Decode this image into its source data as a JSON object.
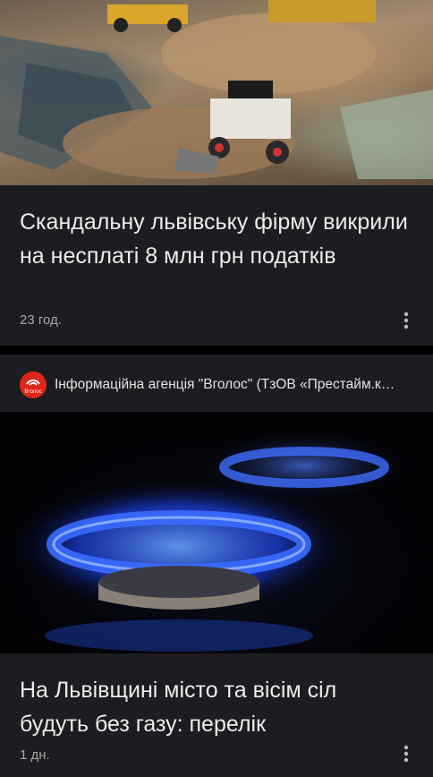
{
  "feed": {
    "articles": [
      {
        "image_desc": "construction-site-photo",
        "headline": "Скандальну львівську фірму викрили на несплаті 8 млн грн податків",
        "time": "23 год."
      },
      {
        "source": "Інформаційна агенція \"Вголос\" (ТзОВ «Престайм.к…",
        "source_logo_text": "Вголос",
        "image_desc": "gas-stove-flame-photo",
        "headline": "На Львівщині місто та вісім сіл будуть без газу: перелік",
        "time": "1 дн."
      }
    ]
  },
  "colors": {
    "card_bg": "#1c1d20",
    "logo_red": "#e1251b",
    "flame_blue": "#2a5cff"
  }
}
